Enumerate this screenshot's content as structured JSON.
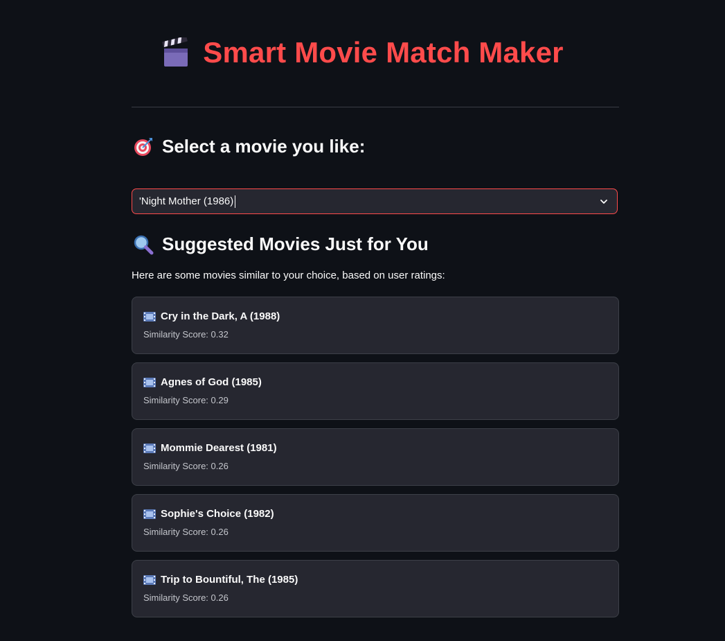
{
  "header": {
    "title": "Smart Movie Match Maker",
    "icon": "clapper-board-icon"
  },
  "select_section": {
    "heading": "Select a movie you like:",
    "icon": "direct-hit-target-icon"
  },
  "movie_select": {
    "value": "'Night Mother (1986)",
    "icon": "chevron-down-icon"
  },
  "suggest_section": {
    "heading": "Suggested Movies Just for You",
    "icon": "magnifying-glass-icon",
    "intro": "Here are some movies similar to your choice, based on user ratings:"
  },
  "recommendations": [
    {
      "title": "Cry in the Dark, A (1988)",
      "score": "Similarity Score: 0.32"
    },
    {
      "title": "Agnes of God (1985)",
      "score": "Similarity Score: 0.29"
    },
    {
      "title": "Mommie Dearest (1981)",
      "score": "Similarity Score: 0.26"
    },
    {
      "title": "Sophie's Choice (1982)",
      "score": "Similarity Score: 0.26"
    },
    {
      "title": "Trip to Bountiful, The (1985)",
      "score": "Similarity Score: 0.26"
    }
  ],
  "colors": {
    "background": "#0e1117",
    "accent": "#ff4b4b",
    "card": "#262730"
  }
}
